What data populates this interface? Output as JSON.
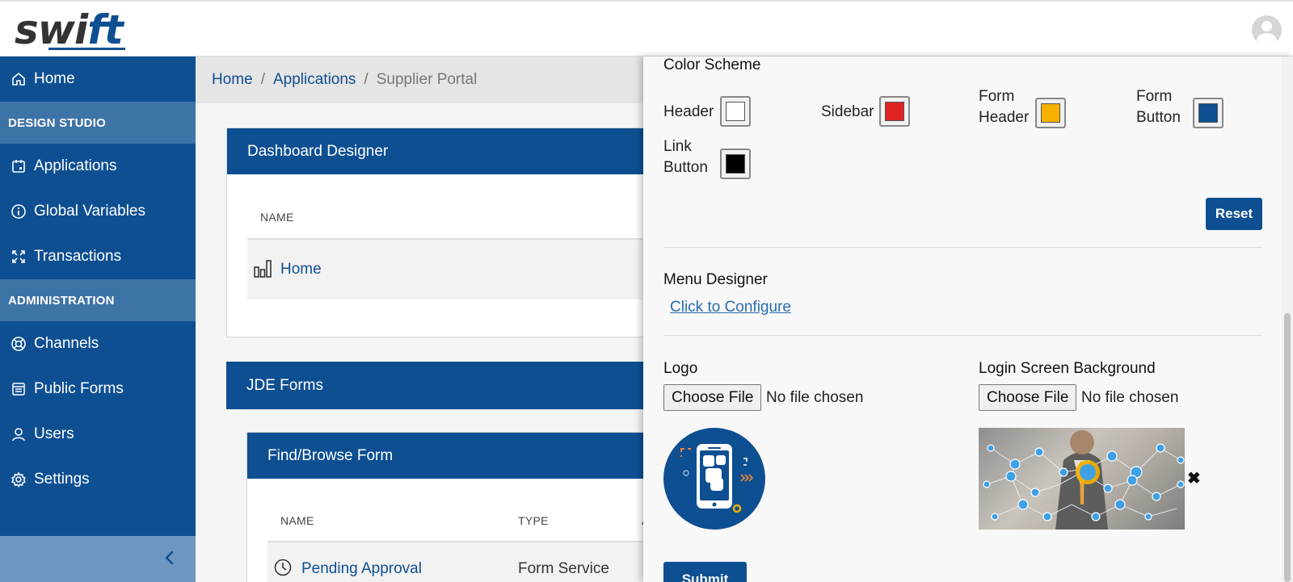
{
  "header": {
    "logo_text_a": "swi",
    "logo_text_b": "ft"
  },
  "sidebar": {
    "home": "Home",
    "section_design": "DESIGN STUDIO",
    "applications": "Applications",
    "global_variables": "Global Variables",
    "transactions": "Transactions",
    "section_admin": "ADMINISTRATION",
    "channels": "Channels",
    "public_forms": "Public Forms",
    "users": "Users",
    "settings": "Settings"
  },
  "breadcrumb": {
    "home": "Home",
    "applications": "Applications",
    "current": "Supplier Portal",
    "separator": "/"
  },
  "dashboard_card": {
    "title": "Dashboard Designer",
    "col_name": "NAME",
    "rows": [
      {
        "name": "Home"
      }
    ]
  },
  "jde_card": {
    "title": "JDE Forms"
  },
  "find_browse_card": {
    "title": "Find/Browse Form",
    "col_name": "NAME",
    "col_type": "TYPE",
    "col_partial": "A",
    "rows": [
      {
        "name": "Pending Approval",
        "type": "Form Service"
      }
    ]
  },
  "panel": {
    "color_scheme_title": "Color Scheme",
    "swatches": {
      "header": {
        "label": "Header",
        "color": "#ffffff"
      },
      "sidebar": {
        "label": "Sidebar",
        "color": "#e02424"
      },
      "form_header": {
        "label_1": "Form",
        "label_2": "Header",
        "color": "#f5b000"
      },
      "form_button": {
        "label_1": "Form",
        "label_2": "Button",
        "color": "#0e4f92"
      },
      "link_button": {
        "label_1": "Link",
        "label_2": "Button",
        "color": "#000000"
      }
    },
    "reset_label": "Reset",
    "menu_designer_title": "Menu Designer",
    "configure_link": "Click to Configure",
    "logo_title": "Logo",
    "login_bg_title": "Login Screen Background",
    "choose_file_label": "Choose File",
    "no_file_text": "No file chosen",
    "remove_icon_text": "✖",
    "submit_label": "Submit"
  },
  "colors": {
    "brand": "#0e4f92",
    "section_bg": "#3e73a8",
    "collapse_bg": "#6f96c0"
  }
}
